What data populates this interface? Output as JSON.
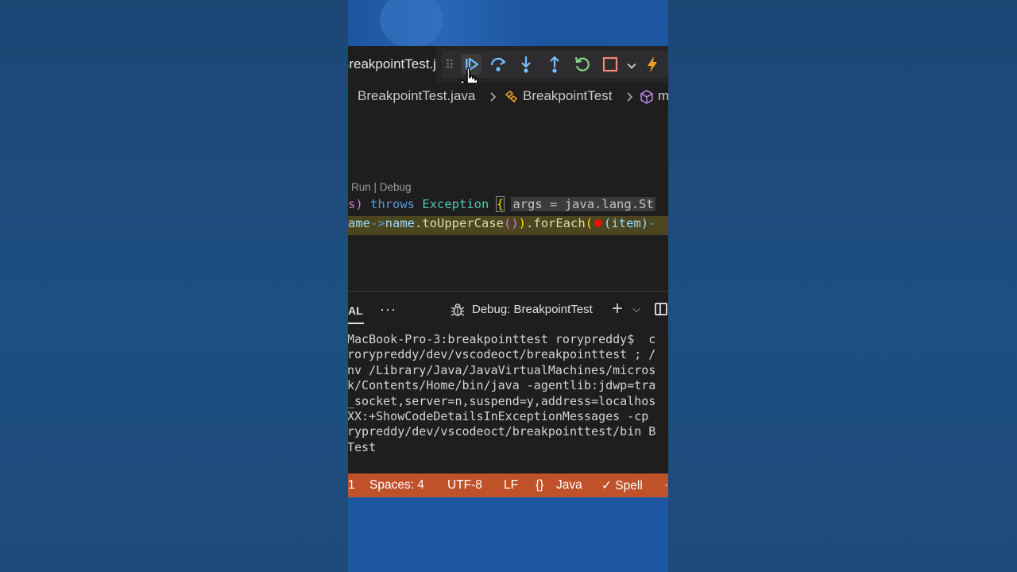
{
  "editor": {
    "tab_label": "BreakpointTest.java",
    "breadcrumbs": {
      "file": "BreakpointTest.java",
      "class": "BreakpointTest",
      "member": "m"
    },
    "codelens": "Run | Debug",
    "line1": {
      "paren": "s)",
      "throws_kw": "throws",
      "exception": "Exception",
      "brace": "{",
      "inline_value": "args = java.lang.St"
    },
    "line2": {
      "lambda_param": "ame",
      "arrow": "->",
      "name_ref": "name",
      "dot1": ".",
      "upper_fn": "toUpperCase",
      "paren_pair": "()",
      "close_paren": ")",
      "dot2": ".",
      "foreach_fn": "forEach",
      "open_paren": "(",
      "item_param": "(item)",
      "tail": "-"
    }
  },
  "debug_toolbar": {
    "buttons": [
      "continue-icon",
      "step-over-icon",
      "step-into-icon",
      "step-out-icon",
      "restart-icon",
      "stop-icon",
      "lightning-icon"
    ],
    "colors": {
      "blue": "#75beff",
      "green": "#89d185",
      "red": "#f48771",
      "orange": "#f0a020"
    }
  },
  "panel": {
    "active_tab": "AL",
    "more": "···",
    "debug_label": "Debug: BreakpointTest",
    "plus": "+",
    "chevron": "⌵"
  },
  "terminal": {
    "lines": [
      "MacBook-Pro-3:breakpointtest rorypreddy$  c",
      "rorypreddy/dev/vscodeoct/breakpointtest ; /",
      "nv /Library/Java/JavaVirtualMachines/micros",
      "k/Contents/Home/bin/java -agentlib:jdwp=tra",
      "_socket,server=n,suspend=y,address=localhos",
      "XX:+ShowCodeDetailsInExceptionMessages -cp ",
      "rypreddy/dev/vscodeoct/breakpointtest/bin B",
      "Test"
    ]
  },
  "status_bar": {
    "line_col": "1",
    "spaces": "Spaces: 4",
    "encoding": "UTF-8",
    "eol": "LF",
    "language_braces": "{}",
    "language": "Java",
    "spell": "✓ Spell",
    "bg_color": "#c0522a"
  }
}
